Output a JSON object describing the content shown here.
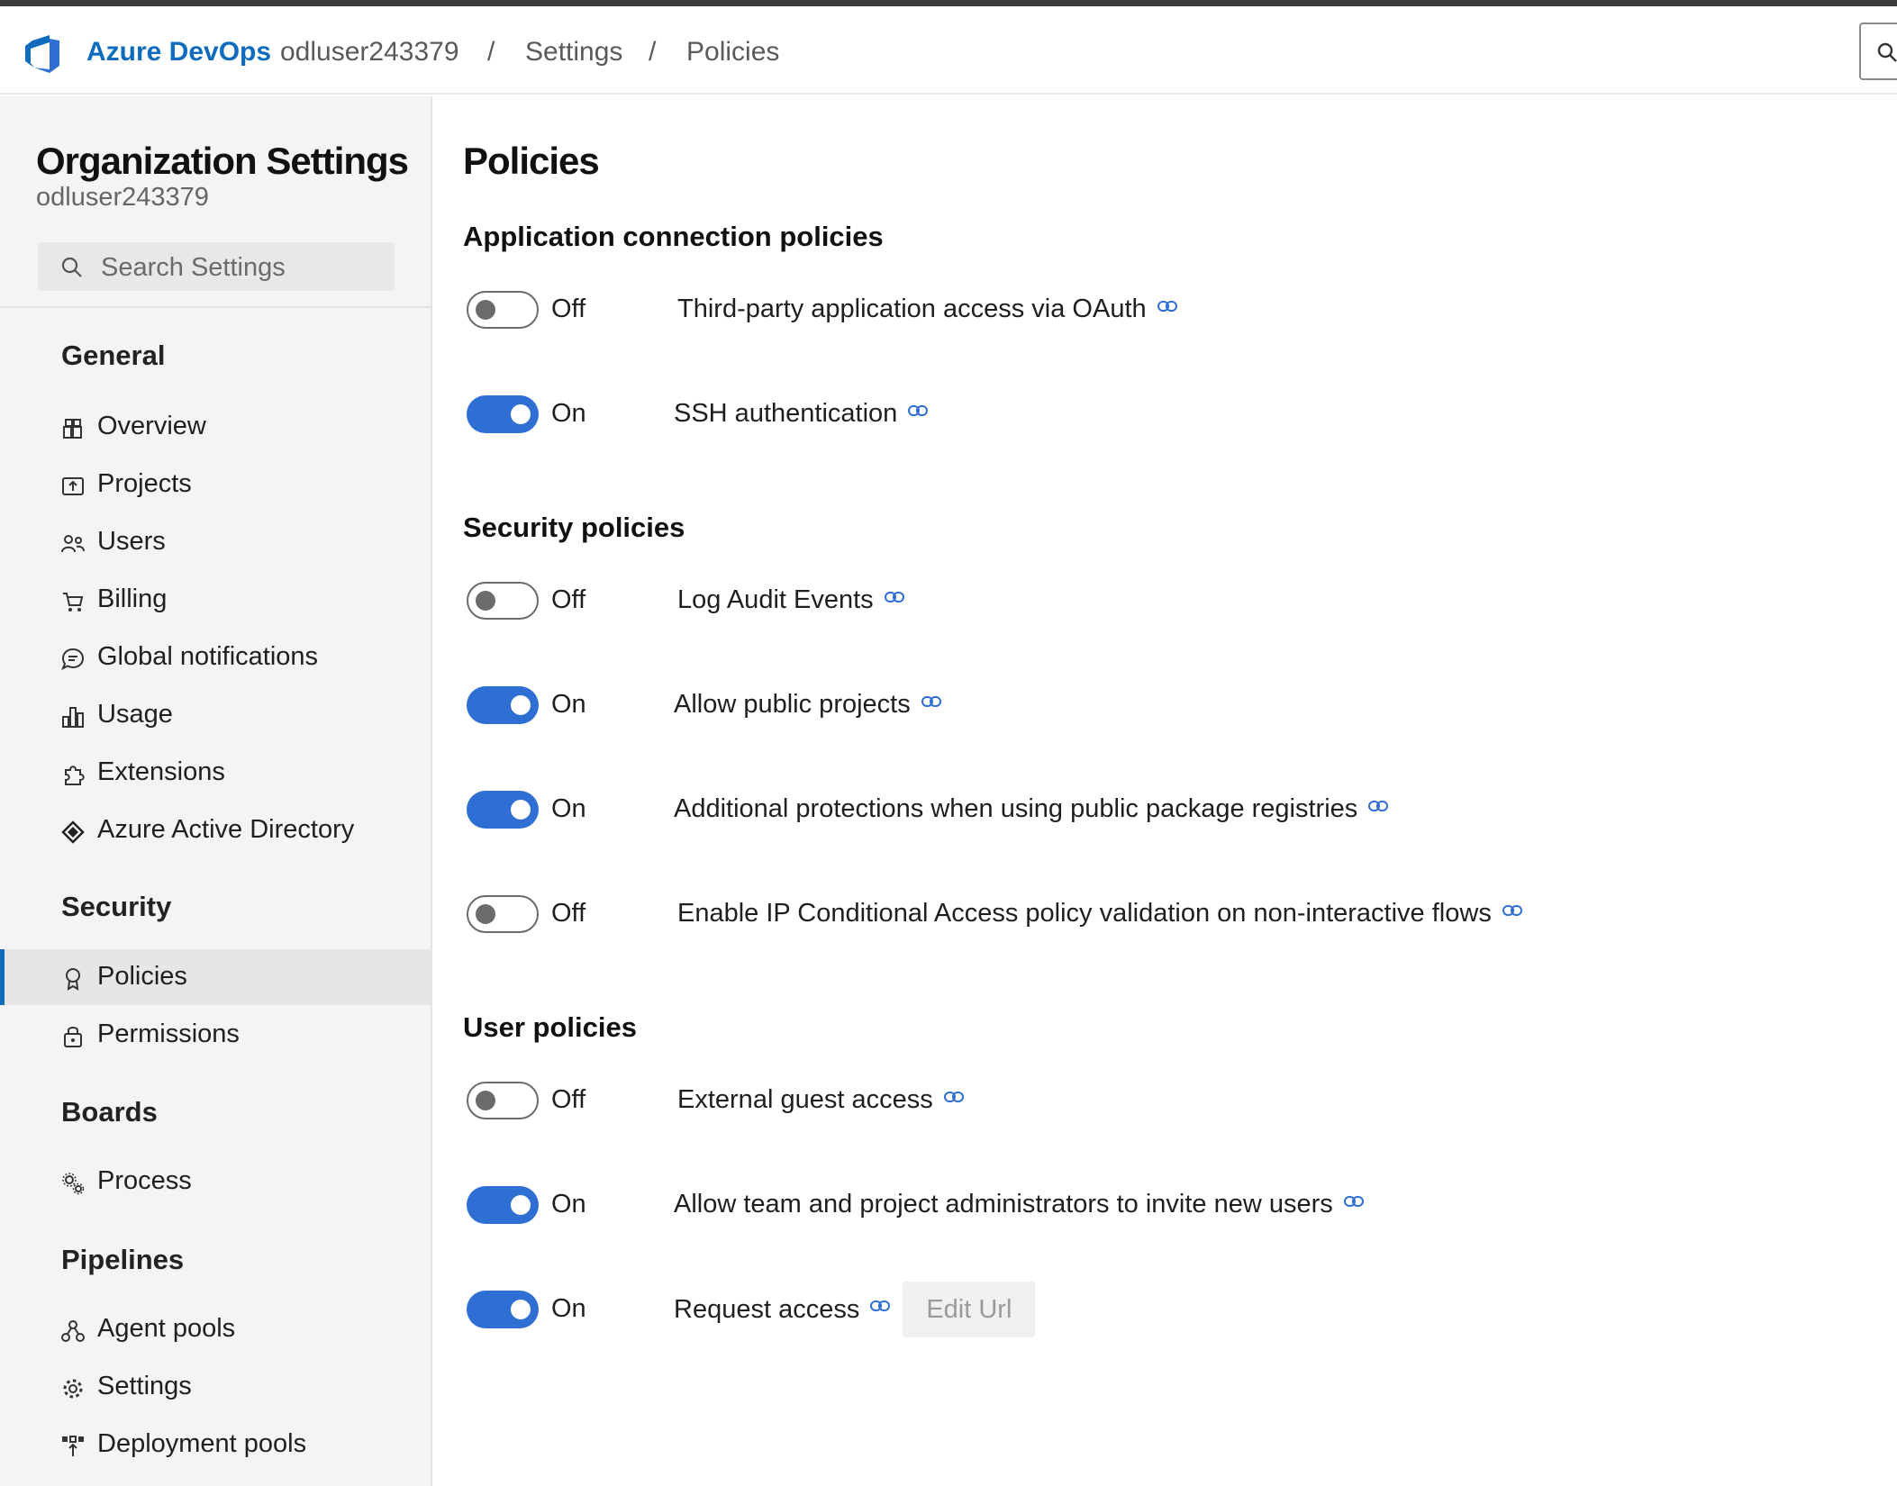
{
  "header": {
    "brand": "Azure DevOps",
    "breadcrumbs": [
      "odluser243379",
      "Settings",
      "Policies"
    ],
    "separator": "/",
    "accent_color": "#0f6cbd"
  },
  "sidebar": {
    "title": "Organization Settings",
    "org": "odluser243379",
    "search_placeholder": "Search Settings",
    "sections": [
      {
        "label": "General",
        "items": [
          {
            "label": "Overview",
            "icon": "overview-icon"
          },
          {
            "label": "Projects",
            "icon": "projects-icon"
          },
          {
            "label": "Users",
            "icon": "users-icon"
          },
          {
            "label": "Billing",
            "icon": "cart-icon"
          },
          {
            "label": "Global notifications",
            "icon": "chat-icon"
          },
          {
            "label": "Usage",
            "icon": "chart-icon"
          },
          {
            "label": "Extensions",
            "icon": "puzzle-icon"
          },
          {
            "label": "Azure Active Directory",
            "icon": "aad-icon"
          }
        ]
      },
      {
        "label": "Security",
        "items": [
          {
            "label": "Policies",
            "icon": "badge-icon",
            "selected": true
          },
          {
            "label": "Permissions",
            "icon": "lock-icon"
          }
        ]
      },
      {
        "label": "Boards",
        "items": [
          {
            "label": "Process",
            "icon": "gears-icon"
          }
        ]
      },
      {
        "label": "Pipelines",
        "items": [
          {
            "label": "Agent pools",
            "icon": "agent-pools-icon"
          },
          {
            "label": "Settings",
            "icon": "gear-icon"
          },
          {
            "label": "Deployment pools",
            "icon": "deployment-pools-icon"
          }
        ]
      }
    ]
  },
  "main": {
    "title": "Policies",
    "sections": [
      {
        "title": "Application connection policies",
        "policies": [
          {
            "enabled": false,
            "state": "Off",
            "label": "Third-party application access via OAuth"
          },
          {
            "enabled": true,
            "state": "On",
            "label": "SSH authentication"
          }
        ]
      },
      {
        "title": "Security policies",
        "policies": [
          {
            "enabled": false,
            "state": "Off",
            "label": "Log Audit Events"
          },
          {
            "enabled": true,
            "state": "On",
            "label": "Allow public projects"
          },
          {
            "enabled": true,
            "state": "On",
            "label": "Additional protections when using public package registries"
          },
          {
            "enabled": false,
            "state": "Off",
            "label": "Enable IP Conditional Access policy validation on non-interactive flows"
          }
        ]
      },
      {
        "title": "User policies",
        "policies": [
          {
            "enabled": false,
            "state": "Off",
            "label": "External guest access"
          },
          {
            "enabled": true,
            "state": "On",
            "label": "Allow team and project administrators to invite new users"
          },
          {
            "enabled": true,
            "state": "On",
            "label": "Request access",
            "button": "Edit Url"
          }
        ]
      }
    ]
  },
  "colors": {
    "toggle_on": "#2f6fd4",
    "toggle_off": "#6b6b6b",
    "sidebar_bg": "#f4f4f4",
    "selected_bg": "#e6e6e6"
  }
}
